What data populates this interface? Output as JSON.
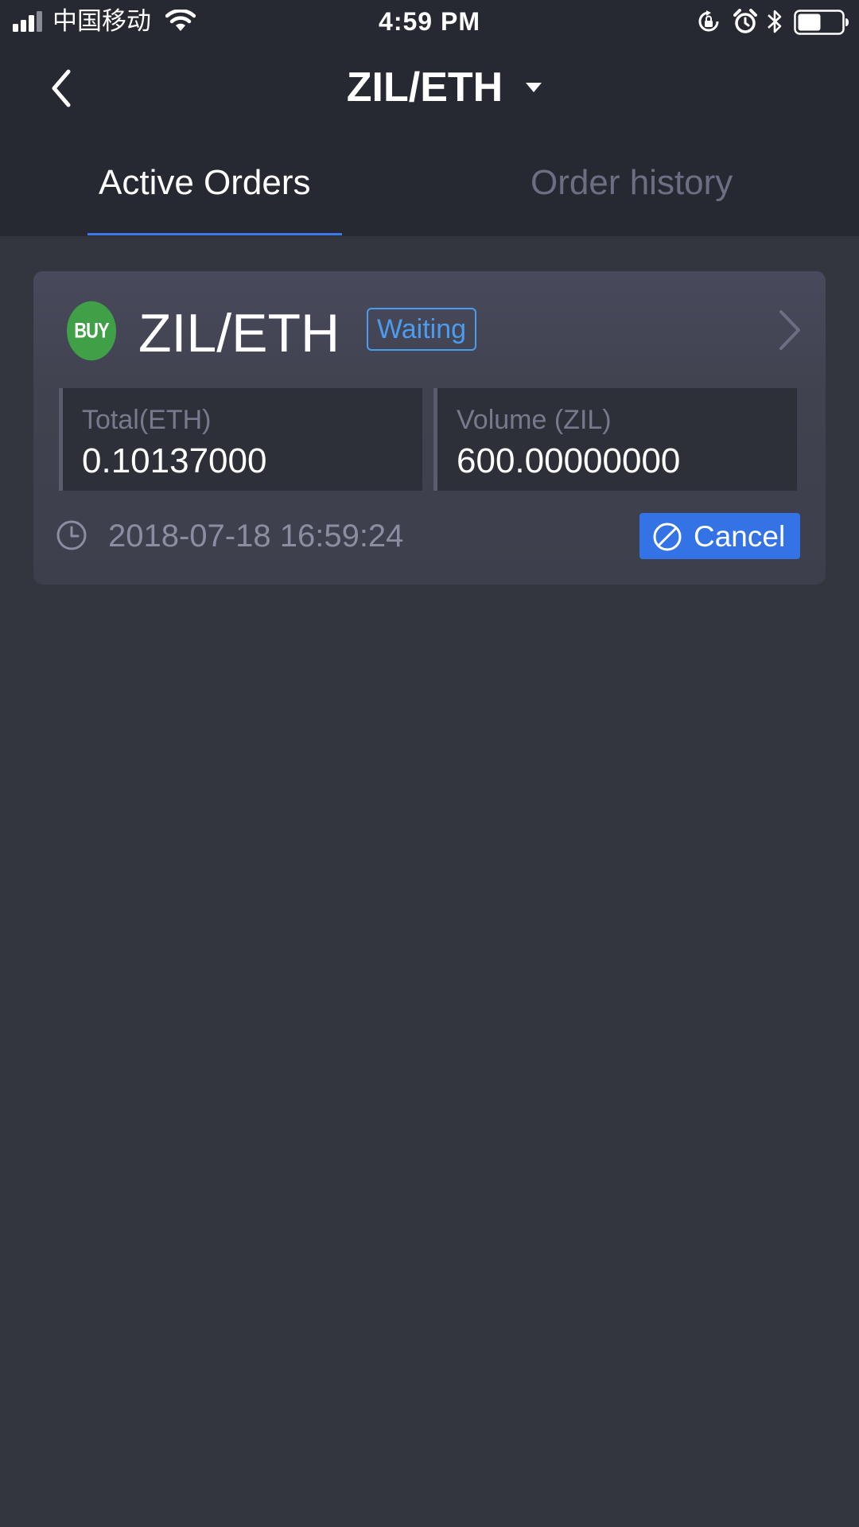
{
  "status_bar": {
    "carrier": "中国移动",
    "time": "4:59 PM"
  },
  "nav": {
    "title": "ZIL/ETH"
  },
  "tabs": [
    {
      "label": "Active Orders",
      "active": true
    },
    {
      "label": "Order history",
      "active": false
    }
  ],
  "order": {
    "side": "BUY",
    "pair": "ZIL/ETH",
    "status": "Waiting",
    "total_label": "Total(ETH)",
    "total_value": "0.10137000",
    "volume_label": "Volume (ZIL)",
    "volume_value": "600.00000000",
    "timestamp": "2018-07-18 16:59:24",
    "cancel_label": "Cancel"
  },
  "colors": {
    "accent": "#3b7ae8",
    "buy": "#3fa047",
    "status": "#4b9cf0",
    "background": "#33353f",
    "header": "#272932"
  },
  "icons": [
    "signal-icon",
    "wifi-icon",
    "rotation-lock-icon",
    "alarm-icon",
    "bluetooth-icon",
    "battery-icon",
    "back-arrow-icon",
    "caret-down-icon",
    "chevron-right-icon",
    "clock-icon",
    "cancel-icon"
  ]
}
